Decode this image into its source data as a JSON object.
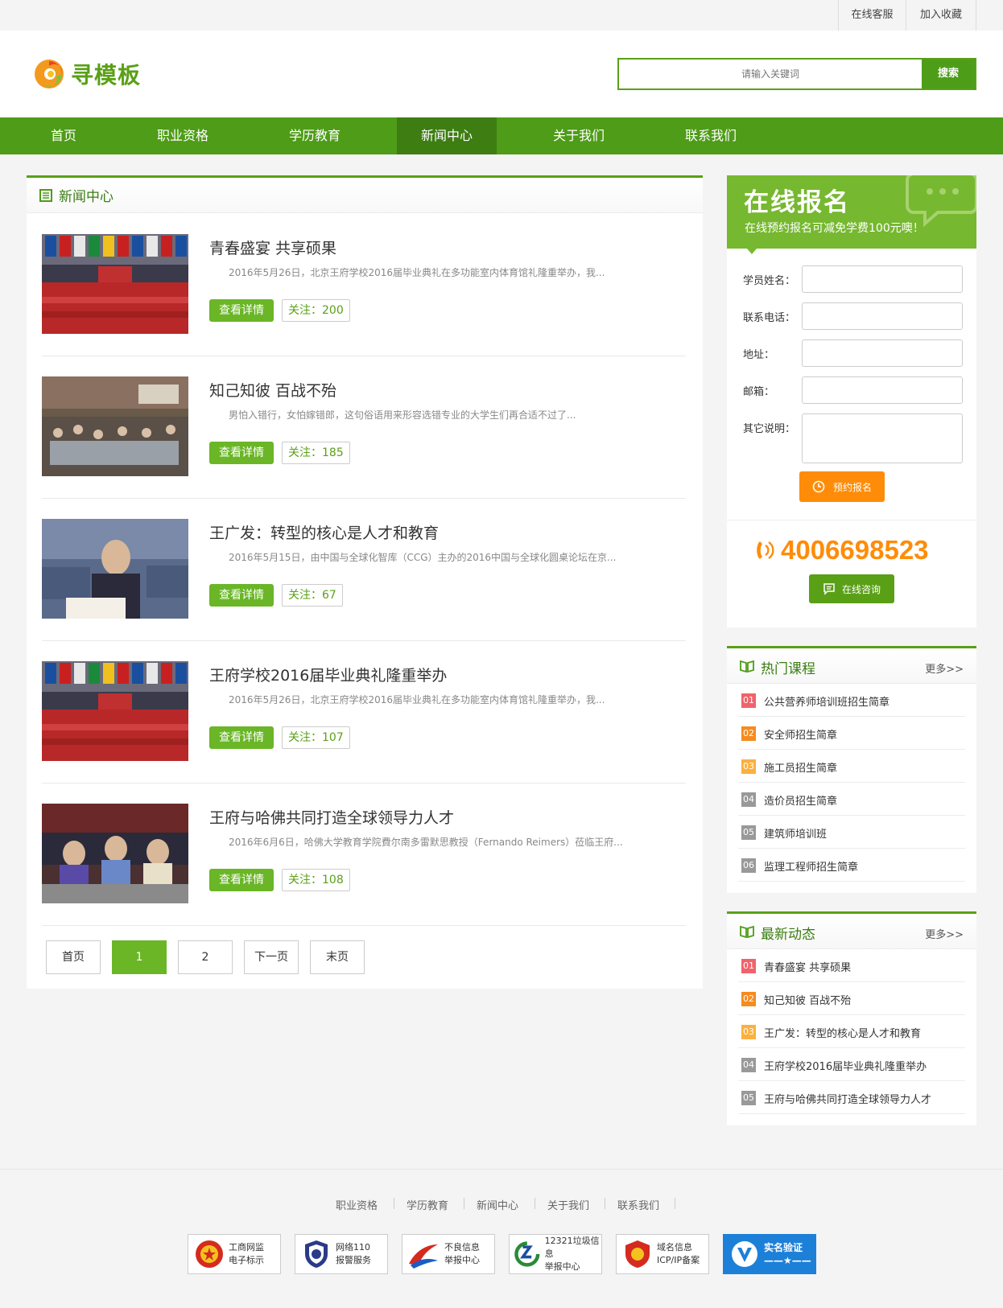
{
  "topbar": {
    "online_service": "在线客服",
    "add_favorite": "加入收藏"
  },
  "header": {
    "logo_text": "寻模板",
    "search_placeholder": "请输入关键词",
    "search_button": "搜索"
  },
  "nav": [
    "首页",
    "职业资格",
    "学历教育",
    "新闻中心",
    "关于我们",
    "联系我们"
  ],
  "nav_active": "新闻中心",
  "main": {
    "section_title": "新闻中心",
    "articles": [
      {
        "title": "青春盛宴 共享硕果",
        "desc": "2016年5月26日，北京王府学校2016届毕业典礼在多功能室内体育馆礼隆重举办，我...",
        "button": "查看详情",
        "views": "关注：200"
      },
      {
        "title": "知己知彼 百战不殆",
        "desc": "男怕入错行，女怕嫁错郎，这句俗语用来形容选错专业的大学生们再合适不过了...",
        "button": "查看详情",
        "views": "关注：185"
      },
      {
        "title": "王广发：转型的核心是人才和教育",
        "desc": "2016年5月15日，由中国与全球化智库（CCG）主办的2016中国与全球化圆桌论坛在京...",
        "button": "查看详情",
        "views": "关注：67"
      },
      {
        "title": "王府学校2016届毕业典礼隆重举办",
        "desc": "2016年5月26日，北京王府学校2016届毕业典礼在多功能室内体育馆礼隆重举办，我...",
        "button": "查看详情",
        "views": "关注：107"
      },
      {
        "title": "王府与哈佛共同打造全球领导力人才",
        "desc": "2016年6月6日，哈佛大学教育学院費尔南多雷默思教授（Fernando Reimers）莅临王府...",
        "button": "查看详情",
        "views": "关注：108"
      }
    ],
    "pager": [
      "首页",
      "1",
      "2",
      "下一页",
      "末页"
    ],
    "pager_current": "1"
  },
  "signup": {
    "title": "在线报名",
    "subtitle": "在线预约报名可减免学费100元噢！",
    "fields": [
      "学员姓名：",
      "联系电话：",
      "地址：",
      "邮箱：",
      "其它说明："
    ],
    "submit": "预约报名",
    "phone": "4006698523",
    "consult": "在线咨询"
  },
  "hot_courses": {
    "title": "热门课程",
    "more": "更多>>",
    "items": [
      "公共营养师培训班招生简章",
      "安全师招生简章",
      "施工员招生简章",
      "造价员招生简章",
      "建筑师培训班",
      "监理工程师招生简章"
    ],
    "nums": [
      "01",
      "02",
      "03",
      "04",
      "05",
      "06"
    ]
  },
  "latest_news": {
    "title": "最新动态",
    "more": "更多>>",
    "items": [
      "青春盛宴 共享硕果",
      "知己知彼 百战不殆",
      "王广发：转型的核心是人才和教育",
      "王府学校2016届毕业典礼隆重举办",
      "王府与哈佛共同打造全球领导力人才"
    ],
    "nums": [
      "01",
      "02",
      "03",
      "04",
      "05"
    ]
  },
  "footer": {
    "links": [
      "职业资格",
      "学历教育",
      "新闻中心",
      "关于我们",
      "联系我们"
    ],
    "badges": [
      {
        "line1": "工商网监",
        "line2": "电子标示"
      },
      {
        "line1": "网络110",
        "line2": "报警服务"
      },
      {
        "line1": "不良信息",
        "line2": "举报中心"
      },
      {
        "line1": "12321垃圾信息",
        "line2": "举报中心"
      },
      {
        "line1": "域名信息",
        "line2": "ICP/IP备案"
      },
      {
        "line1": "实名验证",
        "line2": "——★——"
      }
    ]
  },
  "colors": {
    "brand_green": "#5aa017",
    "nav_green": "#4e9c17",
    "button_green": "#6ab627",
    "orange": "#ff8c08",
    "rank_red": "#f0636b",
    "rank_orange": "#f68b1f",
    "rank_yellow": "#fbb040",
    "rank_gray": "#999999"
  }
}
